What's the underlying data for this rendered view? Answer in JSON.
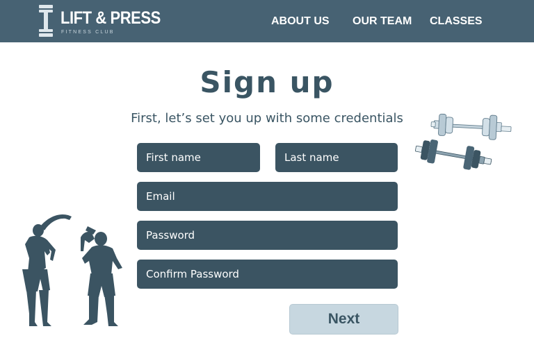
{
  "brand": {
    "name": "LIFT & PRESS",
    "tagline": "FITNESS CLUB",
    "logo_icon": "dumbbell-vertical-icon"
  },
  "nav": {
    "about": "ABOUT US",
    "team": "OUR TEAM",
    "classes": "CLASSES"
  },
  "page": {
    "title": "Sign up",
    "subtitle": "First, let’s set you up with some credentials"
  },
  "form": {
    "first_name_placeholder": "First name",
    "last_name_placeholder": "Last name",
    "email_placeholder": "Email",
    "password_placeholder": "Password",
    "confirm_password_placeholder": "Confirm Password",
    "next_label": "Next"
  },
  "illustrations": {
    "dumbbells": "barbells-illustration",
    "people": "stretching-people-illustration"
  },
  "colors": {
    "header_bg": "#476273",
    "field_bg": "#3b5462",
    "text_dark": "#3a5563",
    "button_bg": "#c7d7e0"
  }
}
